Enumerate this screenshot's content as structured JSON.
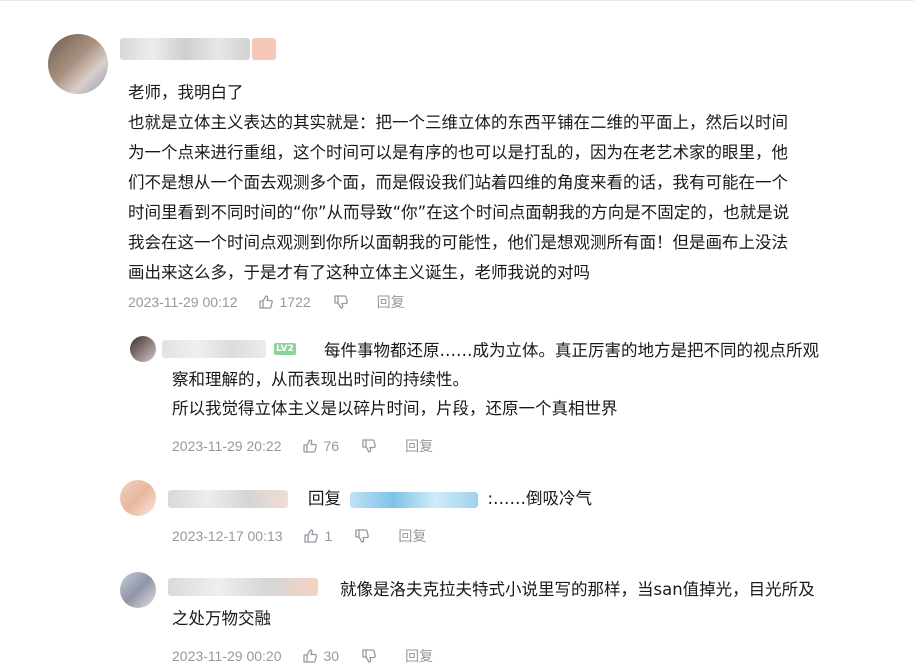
{
  "main_comment": {
    "text_lines": [
      "老师，我明白了",
      "也就是立体主义表达的其实就是：把一个三维立体的东西平铺在二维的平面上，然后以时间",
      "为一个点来进行重组，这个时间可以是有序的也可以是打乱的，因为在老艺术家的眼里，他",
      "们不是想从一个面去观测多个面，而是假设我们站着四维的角度来看的话，我有可能在一个",
      "时间里看到不同时间的“你”从而导致“你”在这个时间点面朝我的方向是不固定的，也就是说",
      "我会在这一个时间点观测到你所以面朝我的可能性，他们是想观测所有面！但是画布上没法",
      "画出来这么多，于是才有了这种立体主义诞生，老师我说的对吗"
    ],
    "time": "2023-11-29 00:12",
    "likes": "1722",
    "reply_label": "回复"
  },
  "replies": [
    {
      "level": "LV2",
      "text_lines": [
        "每件事物都还原……成为立体。真正厉害的地方是把不同的视点所观",
        "察和理解的，从而表现出时间的持续性。",
        "所以我觉得立体主义是以碎片时间，片段，还原一个真相世界"
      ],
      "time": "2023-11-29 20:22",
      "likes": "76",
      "reply_label": "回复"
    },
    {
      "prefix": "回复",
      "text_lines": [
        ":……倒吸冷气"
      ],
      "time": "2023-12-17 00:13",
      "likes": "1",
      "reply_label": "回复"
    },
    {
      "text_lines": [
        "就像是洛夫克拉夫特式小说里写的那样，当san值掉光，目光所及",
        "之处万物交融"
      ],
      "time": "2023-11-29 00:20",
      "likes": "30",
      "reply_label": "回复"
    }
  ],
  "colors": {
    "text": "#18191c",
    "meta": "#9499a0",
    "level_badge": "#8bd29b",
    "mention_blur": "#7fc3e8"
  }
}
